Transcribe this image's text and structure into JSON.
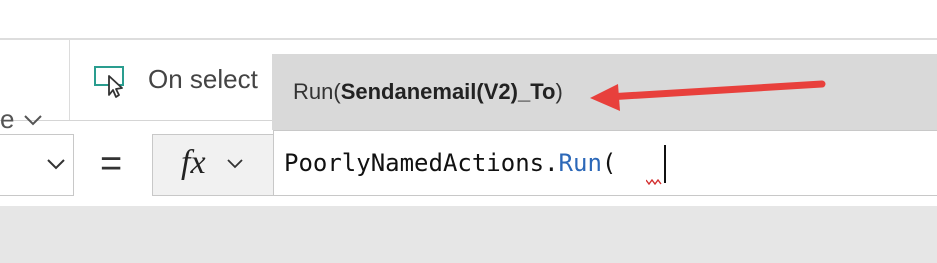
{
  "property_selector_partial": {
    "visible_text": "e"
  },
  "event": {
    "label": "On select",
    "icon": "select-pointer-icon"
  },
  "tooltip": {
    "prefix": "Run(",
    "bold": "Sendanemail(V2)_To",
    "suffix": ")"
  },
  "formula": {
    "object": "PoorlyNamedActions.",
    "method": "Run",
    "open_paren": "("
  },
  "equals": "=",
  "fx": {
    "label": "fx"
  },
  "colors": {
    "arrow": "#e8403c",
    "method": "#2c68b8",
    "tooltip_bg": "#d9d9d9",
    "bottom_bar": "#e6e6e6"
  }
}
